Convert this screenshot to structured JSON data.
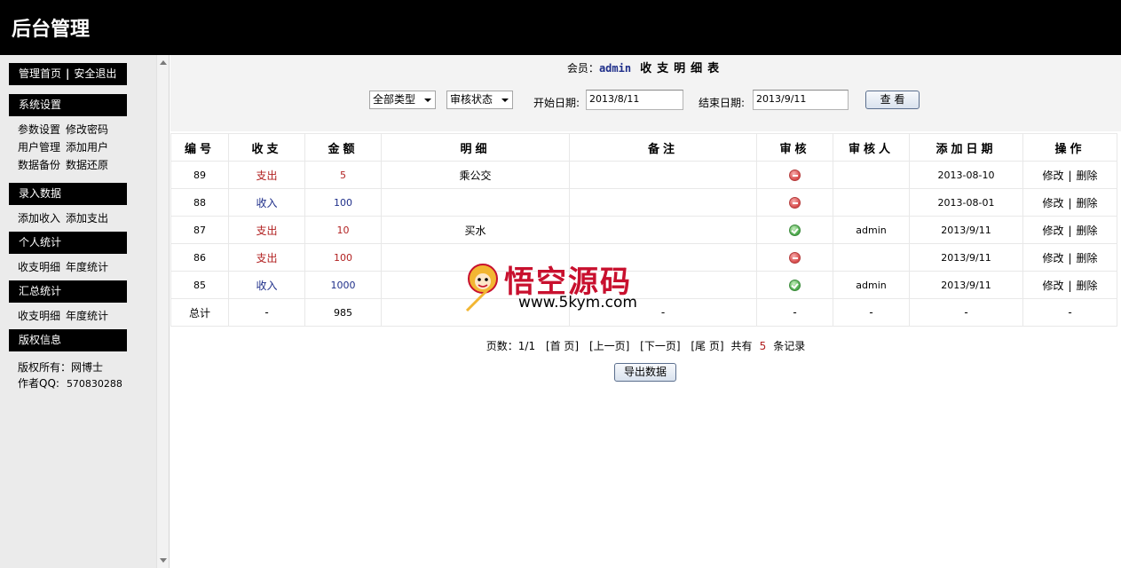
{
  "header": {
    "title": "后台管理"
  },
  "sidebar": {
    "topnav": {
      "home": "管理首页",
      "separator": "|",
      "logout": "安全退出"
    },
    "sections": [
      {
        "title": "系统设置",
        "links": [
          [
            "参数设置",
            "修改密码"
          ],
          [
            "用户管理",
            "添加用户"
          ],
          [
            "数据备份",
            "数据还原"
          ]
        ]
      },
      {
        "title": "录入数据",
        "links": [
          [
            "添加收入",
            "添加支出"
          ]
        ]
      },
      {
        "title": "个人统计",
        "links": [
          [
            "收支明细",
            "年度统计"
          ]
        ]
      },
      {
        "title": "汇总统计",
        "links": [
          [
            "收支明细",
            "年度统计"
          ]
        ]
      },
      {
        "title": "版权信息",
        "links": []
      }
    ],
    "copyright": {
      "owner": "版权所有：网博士",
      "qq_label": "作者QQ:",
      "qq_number": "570830288"
    }
  },
  "main": {
    "title": {
      "member_label": "会员：",
      "member_name": "admin",
      "heading": "收支明细表"
    },
    "filters": {
      "type_select": "全部类型",
      "status_select": "审核状态",
      "start_label": "开始日期:",
      "start_value": "2013/8/11",
      "end_label": "结束日期:",
      "end_value": "2013/9/11",
      "view_button": "查 看"
    },
    "table": {
      "columns": [
        "编号",
        "收支",
        "金额",
        "明细",
        "备注",
        "审核",
        "审核人",
        "添加日期",
        "操作"
      ],
      "rows": [
        {
          "id": "89",
          "type": "支出",
          "kind": "out",
          "amount": "5",
          "detail": "乘公交",
          "note": "",
          "status": "rejected",
          "reviewer": "",
          "date": "2013-08-10"
        },
        {
          "id": "88",
          "type": "收入",
          "kind": "in",
          "amount": "100",
          "detail": "",
          "note": "",
          "status": "rejected",
          "reviewer": "",
          "date": "2013-08-01"
        },
        {
          "id": "87",
          "type": "支出",
          "kind": "out",
          "amount": "10",
          "detail": "买水",
          "note": "",
          "status": "approved",
          "reviewer": "admin",
          "date": "2013/9/11"
        },
        {
          "id": "86",
          "type": "支出",
          "kind": "out",
          "amount": "100",
          "detail": "",
          "note": "",
          "status": "rejected",
          "reviewer": "",
          "date": "2013/9/11"
        },
        {
          "id": "85",
          "type": "收入",
          "kind": "in",
          "amount": "1000",
          "detail": "",
          "note": "",
          "status": "approved",
          "reviewer": "admin",
          "date": "2013/9/11"
        }
      ],
      "ops": {
        "edit": "修改",
        "sep": "|",
        "delete": "删除"
      },
      "total": {
        "label": "总计",
        "type": "-",
        "amount": "985",
        "detail": "",
        "note": "-",
        "status": "-",
        "reviewer": "-",
        "date": "-",
        "ops": "-"
      }
    },
    "pager": {
      "pages": "页数：1/1",
      "first": "[首 页]",
      "prev": "[上一页]",
      "next": "[下一页]",
      "last": "[尾 页]",
      "total_prefix": "共有",
      "total_count": "5",
      "total_suffix": "条记录"
    },
    "export_button": "导出数据"
  },
  "watermark": {
    "text": "悟空源码",
    "url": "www.5kym.com"
  },
  "colors": {
    "expense": "#b22222",
    "income": "#1f2f8a",
    "header_bg": "#000000",
    "sidebar_bg": "#ebebeb"
  },
  "icons": {
    "rejected": "minus-circle-icon",
    "approved": "check-circle-icon"
  }
}
